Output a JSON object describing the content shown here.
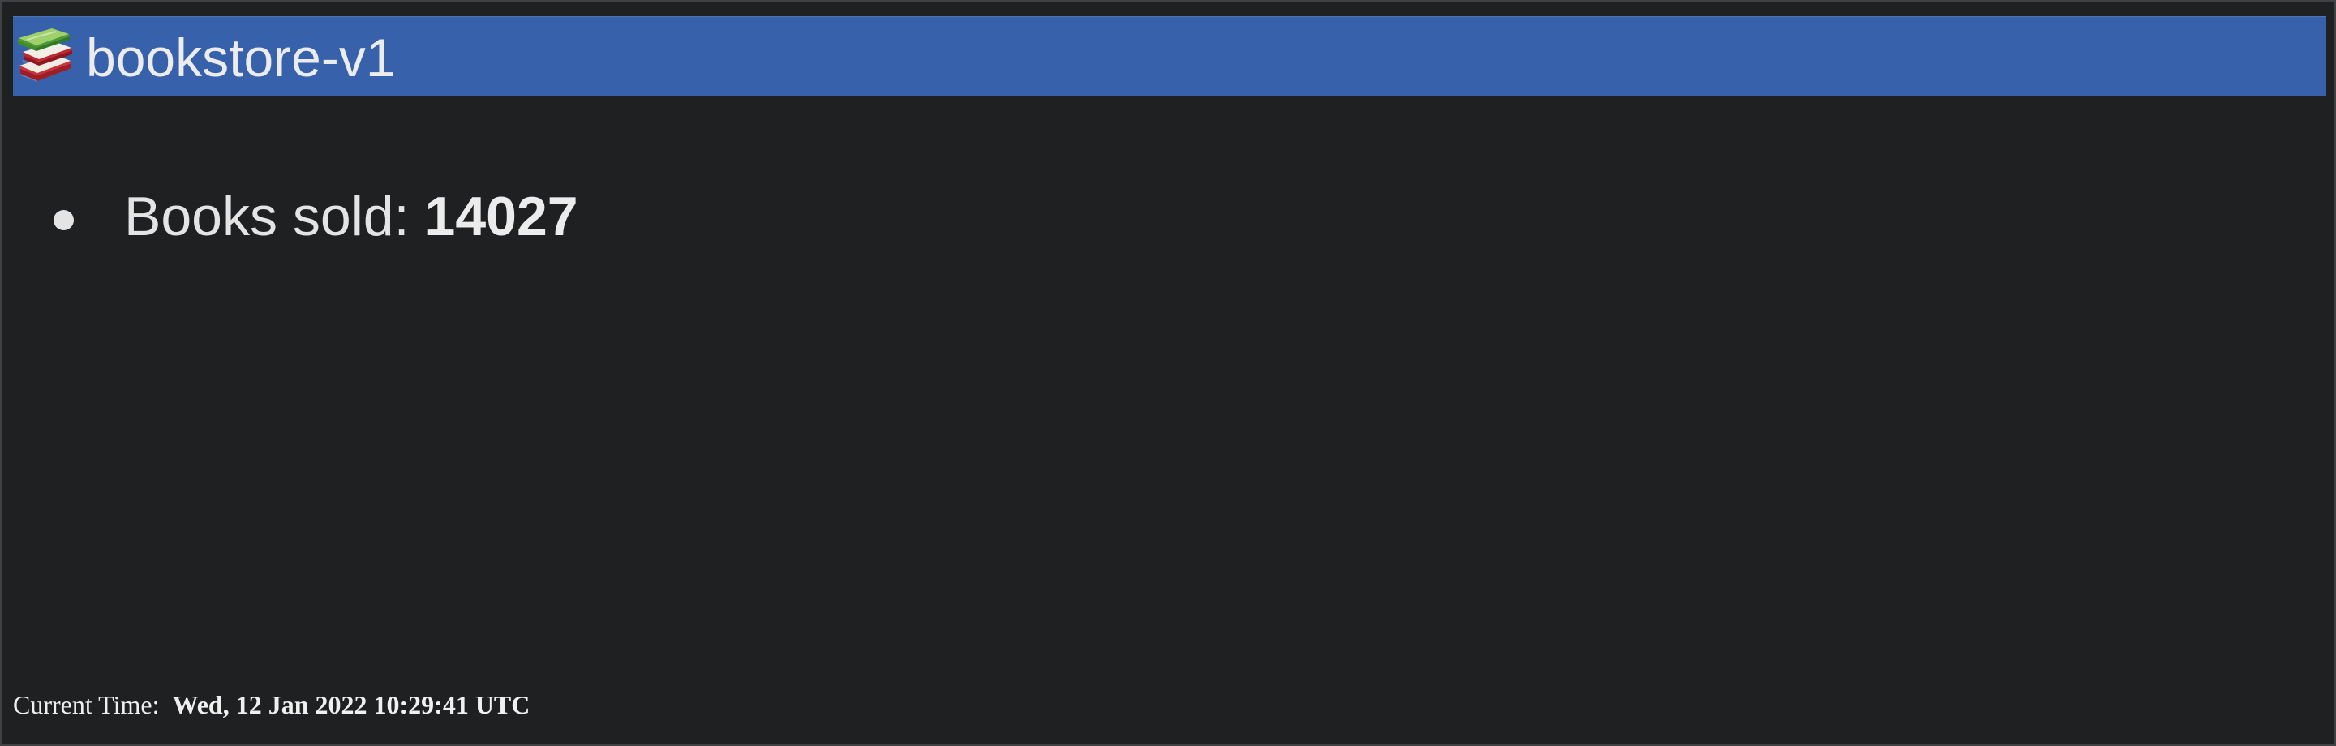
{
  "header": {
    "title": "bookstore-v1",
    "icon": "books-icon"
  },
  "stats": {
    "items": [
      {
        "label": "Books sold:",
        "value": "14027"
      }
    ]
  },
  "footer": {
    "time_label": "Current Time:",
    "time_value": "Wed, 12 Jan 2022 10:29:41 UTC"
  },
  "colors": {
    "background": "#1f2022",
    "header_background": "#3761aa",
    "text": "#e4e4e4"
  }
}
